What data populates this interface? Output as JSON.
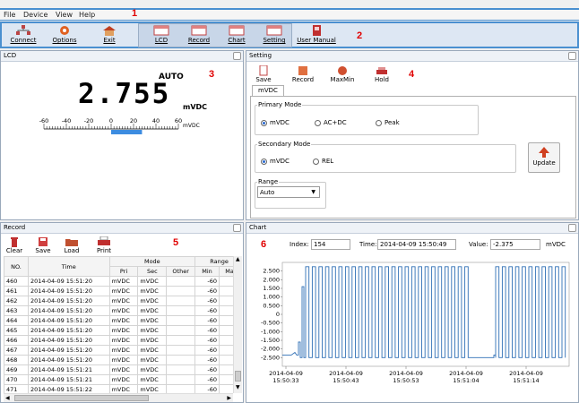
{
  "menu": {
    "items": [
      "File",
      "Device",
      "View",
      "Help"
    ]
  },
  "markers": {
    "menu": "1",
    "toolbar": "2",
    "lcd": "3",
    "setting": "4",
    "record": "5",
    "chart": "6"
  },
  "toolbar": {
    "connect": "Connect",
    "options": "Options",
    "exit": "Exit",
    "lcd": "LCD",
    "record": "Record",
    "chart": "Chart",
    "setting": "Setting",
    "manual": "User Manual"
  },
  "lcd": {
    "title": "LCD",
    "mode": "AUTO",
    "value": "2.755",
    "unit": "mVDC",
    "scale_unit": "mVDC",
    "scale_ticks": [
      "-60",
      "-40",
      "-20",
      "0",
      "20",
      "40",
      "60"
    ],
    "bar_value": 27.55
  },
  "setting": {
    "title": "Setting",
    "tools": {
      "save": "Save",
      "record": "Record",
      "maxmin": "MaxMin",
      "hold": "Hold"
    },
    "tab": "mVDC",
    "primary_label": "Primary Mode",
    "primary_options": [
      "mVDC",
      "AC+DC",
      "Peak"
    ],
    "primary_selected": "mVDC",
    "secondary_label": "Secondary Mode",
    "secondary_options": [
      "mVDC",
      "REL"
    ],
    "secondary_selected": "mVDC",
    "range_label": "Range",
    "range_value": "Auto",
    "update": "Update"
  },
  "record": {
    "title": "Record",
    "tools": {
      "clear": "Clear",
      "save": "Save",
      "load": "Load",
      "print": "Print"
    },
    "headers": {
      "no": "NO.",
      "time": "Time",
      "mode": "Mode",
      "range": "Range",
      "pri": "Pri",
      "sec": "Sec",
      "other": "Other",
      "min": "Min",
      "max": "Max"
    },
    "rows": [
      {
        "no": "460",
        "time": "2014-04-09 15:51:20",
        "pri": "mVDC",
        "sec": "mVDC",
        "other": "",
        "min": "-60"
      },
      {
        "no": "461",
        "time": "2014-04-09 15:51:20",
        "pri": "mVDC",
        "sec": "mVDC",
        "other": "",
        "min": "-60"
      },
      {
        "no": "462",
        "time": "2014-04-09 15:51:20",
        "pri": "mVDC",
        "sec": "mVDC",
        "other": "",
        "min": "-60"
      },
      {
        "no": "463",
        "time": "2014-04-09 15:51:20",
        "pri": "mVDC",
        "sec": "mVDC",
        "other": "",
        "min": "-60"
      },
      {
        "no": "464",
        "time": "2014-04-09 15:51:20",
        "pri": "mVDC",
        "sec": "mVDC",
        "other": "",
        "min": "-60"
      },
      {
        "no": "465",
        "time": "2014-04-09 15:51:20",
        "pri": "mVDC",
        "sec": "mVDC",
        "other": "",
        "min": "-60"
      },
      {
        "no": "466",
        "time": "2014-04-09 15:51:20",
        "pri": "mVDC",
        "sec": "mVDC",
        "other": "",
        "min": "-60"
      },
      {
        "no": "467",
        "time": "2014-04-09 15:51:20",
        "pri": "mVDC",
        "sec": "mVDC",
        "other": "",
        "min": "-60"
      },
      {
        "no": "468",
        "time": "2014-04-09 15:51:20",
        "pri": "mVDC",
        "sec": "mVDC",
        "other": "",
        "min": "-60"
      },
      {
        "no": "469",
        "time": "2014-04-09 15:51:21",
        "pri": "mVDC",
        "sec": "mVDC",
        "other": "",
        "min": "-60"
      },
      {
        "no": "470",
        "time": "2014-04-09 15:51:21",
        "pri": "mVDC",
        "sec": "mVDC",
        "other": "",
        "min": "-60"
      },
      {
        "no": "471",
        "time": "2014-04-09 15:51:22",
        "pri": "mVDC",
        "sec": "mVDC",
        "other": "",
        "min": "-60"
      }
    ]
  },
  "chart": {
    "title": "Chart",
    "index_label": "Index:",
    "index_value": "154",
    "time_label": "Time:",
    "time_value": "2014-04-09 15:50:49",
    "value_label": "Value:",
    "value_value": "-2.375",
    "unit": "mVDC"
  },
  "chart_data": {
    "type": "line",
    "ylim": [
      -3.0,
      3.0
    ],
    "y_ticks": [
      "2.500",
      "2.000",
      "1.500",
      "1.000",
      "0.500",
      "0",
      "-0.500",
      "-1.000",
      "-1.500",
      "-2.000",
      "-2.500"
    ],
    "y_tick_values": [
      2.5,
      2.0,
      1.5,
      1.0,
      0.5,
      0,
      -0.5,
      -1.0,
      -1.5,
      -2.0,
      -2.5
    ],
    "x_ticks": [
      [
        "2014-04-09",
        "15:50:33"
      ],
      [
        "2014-04-09",
        "15:50:43"
      ],
      [
        "2014-04-09",
        "15:50:53"
      ],
      [
        "2014-04-09",
        "15:51:04"
      ],
      [
        "2014-04-09",
        "15:51:14"
      ]
    ],
    "series": [
      {
        "high": 2.75,
        "low": -2.5,
        "idle": -2.35,
        "color": "#2f6fb5"
      }
    ]
  }
}
